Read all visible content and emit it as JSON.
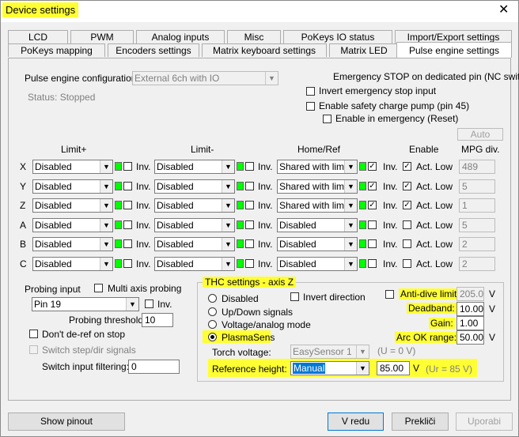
{
  "window": {
    "title": "Device settings",
    "close_glyph": "✕"
  },
  "tabs_row1": [
    "LCD",
    "PWM",
    "Analog inputs",
    "Misc",
    "PoKeys IO status",
    "Import/Export settings"
  ],
  "tabs_row2": [
    "PoKeys mapping",
    "Encoders settings",
    "Matrix keyboard settings",
    "Matrix LED",
    "Pulse engine settings"
  ],
  "config": {
    "label": "Pulse engine configuration:",
    "value": "External 6ch with IO",
    "status": "Status: Stopped"
  },
  "estop": {
    "title": "Emergency STOP on dedicated pin (NC switcl",
    "invert": "Invert emergency stop input",
    "charge_pump": "Enable safety charge pump (pin 45)",
    "enable_emergency": "Enable in emergency (Reset)",
    "auto": "Auto"
  },
  "headers": {
    "limit_plus": "Limit+",
    "limit_minus": "Limit-",
    "home_ref": "Home/Ref",
    "enable": "Enable",
    "mpg_div": "MPG div."
  },
  "common": {
    "inv": "Inv.",
    "act_low": "Act. Low"
  },
  "axes": [
    {
      "name": "X",
      "limp": "Disabled",
      "limm": "Disabled",
      "home": "Shared with limit-",
      "home_inv": true,
      "act_low": true,
      "mpg": "489"
    },
    {
      "name": "Y",
      "limp": "Disabled",
      "limm": "Disabled",
      "home": "Shared with limit-",
      "home_inv": true,
      "act_low": true,
      "mpg": "5"
    },
    {
      "name": "Z",
      "limp": "Disabled",
      "limm": "Disabled",
      "home": "Shared with limit+",
      "home_inv": true,
      "act_low": true,
      "mpg": "1"
    },
    {
      "name": "A",
      "limp": "Disabled",
      "limm": "Disabled",
      "home": "Disabled",
      "home_inv": false,
      "act_low": false,
      "mpg": "5"
    },
    {
      "name": "B",
      "limp": "Disabled",
      "limm": "Disabled",
      "home": "Disabled",
      "home_inv": false,
      "act_low": false,
      "mpg": "2"
    },
    {
      "name": "C",
      "limp": "Disabled",
      "limm": "Disabled",
      "home": "Disabled",
      "home_inv": false,
      "act_low": false,
      "mpg": "2"
    }
  ],
  "probing": {
    "input_label": "Probing input",
    "multi_axis": "Multi axis probing",
    "pin": "Pin 19",
    "inv": "Inv.",
    "threshold_label": "Probing threshold:",
    "threshold": "10",
    "deref": "Don't de-ref on stop",
    "switch_step": "Switch step/dir signals",
    "filter_label": "Switch input filtering:",
    "filter": "0"
  },
  "thc": {
    "title": "THC settings - axis Z",
    "modes": [
      "Disabled",
      "Up/Down signals",
      "Voltage/analog mode",
      "PlasmaSens"
    ],
    "invert_direction": "Invert direction",
    "torch_label": "Torch voltage:",
    "torch_value": "EasySensor 1",
    "torch_u": "(U = 0 V)",
    "ref_label": "Reference height:",
    "ref_mode": "Manual",
    "ref_value": "85.00",
    "ref_unit": "V",
    "ref_ur": "(Ur = 85 V)",
    "antidive_label": "Anti-dive limit:",
    "antidive": "205.00",
    "deadband_label": "Deadband:",
    "deadband": "10.00",
    "gain_label": "Gain:",
    "gain": "1.00",
    "arcok_label": "Arc OK range:",
    "arcok": "50.00",
    "unit_v": "V"
  },
  "buttons": {
    "show_pinout": "Show pinout",
    "ok": "V redu",
    "cancel": "Prekliči",
    "apply": "Uporabi"
  }
}
